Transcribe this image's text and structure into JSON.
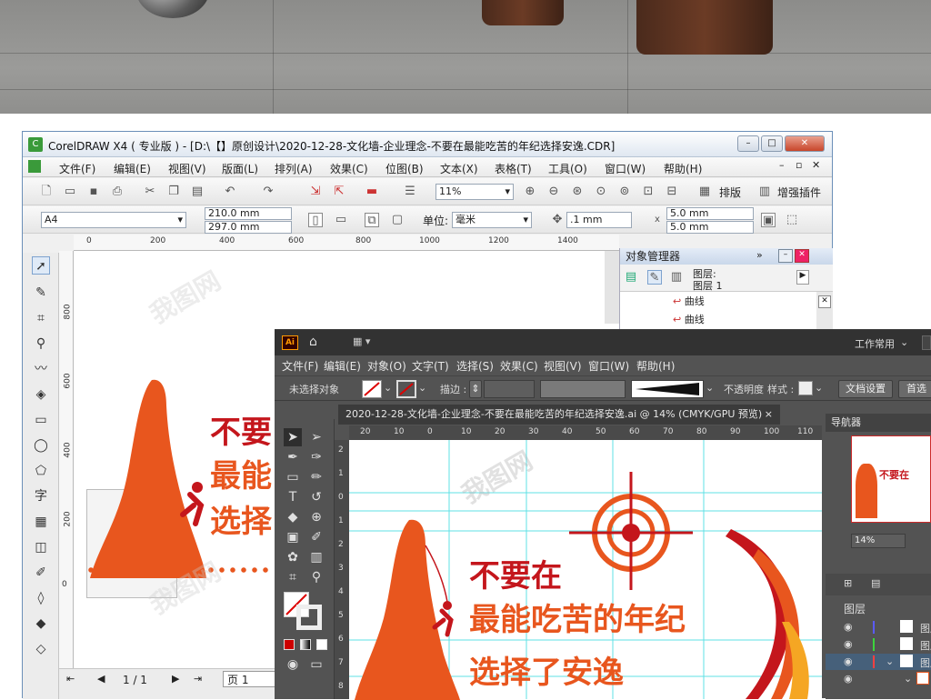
{
  "cdr": {
    "title": "CorelDRAW X4 ( 专业版 ) - [D:\\【】原创设计\\2020-12-28-文化墙-企业理念-不要在最能吃苦的年纪选择安逸.CDR]",
    "menu": [
      "文件(F)",
      "编辑(E)",
      "视图(V)",
      "版面(L)",
      "排列(A)",
      "效果(C)",
      "位图(B)",
      "文本(X)",
      "表格(T)",
      "工具(O)",
      "窗口(W)",
      "帮助(H)"
    ],
    "zoom": "11%",
    "layout_btn": "排版",
    "plugin_btn": "增强插件",
    "page_size": "A4",
    "width": "210.0 mm",
    "height": "297.0 mm",
    "unit_label": "单位:",
    "unit_value": "毫米",
    "nudge": ".1 mm",
    "dup_x": "5.0 mm",
    "dup_y": "5.0 mm",
    "ruler_h": [
      "0",
      "200",
      "400",
      "600",
      "800",
      "1000",
      "1200",
      "1400"
    ],
    "ruler_v": [
      "800",
      "600",
      "400",
      "200",
      "0"
    ],
    "page_nav": "1 / 1",
    "page_tab": "页 1",
    "object_manager": {
      "title": "对象管理器",
      "layer_line1": "图层:",
      "layer_line2": "图层 1",
      "items": [
        "曲线",
        "曲线"
      ]
    },
    "poster": {
      "line1": "不要",
      "line2": "最能",
      "line3": "选择"
    }
  },
  "ai": {
    "logo": "Ai",
    "workspace": "工作常用",
    "menu": [
      "文件(F)",
      "编辑(E)",
      "对象(O)",
      "文字(T)",
      "选择(S)",
      "效果(C)",
      "视图(V)",
      "窗口(W)",
      "帮助(H)"
    ],
    "no_selection": "未选择对象",
    "stroke_label": "描边 :",
    "opacity_label": "不透明度",
    "style_label": "样式 :",
    "doc_setup": "文档设置",
    "prefs": "首选",
    "doc_tab": "2020-12-28-文化墙-企业理念-不要在最能吃苦的年纪选择安逸.ai @ 14% (CMYK/GPU 预览)",
    "ruler_h": [
      "20",
      "10",
      "0",
      "10",
      "20",
      "30",
      "40",
      "50",
      "60",
      "70",
      "80",
      "90",
      "100",
      "110"
    ],
    "ruler_v": [
      "2",
      "1",
      "0",
      "1",
      "2",
      "3",
      "4",
      "5",
      "6",
      "7",
      "8"
    ],
    "navigator": "导航器",
    "nav_zoom": "14%",
    "layers_title": "图层",
    "layers": [
      "图层",
      "图层",
      "图层"
    ],
    "poster": {
      "line1": "不要在",
      "line2": "最能吃苦的年纪",
      "line3": "选择了安逸"
    }
  },
  "colors": {
    "orange": "#e8561e",
    "red": "#c4161c",
    "ai_dark": "#535353"
  }
}
